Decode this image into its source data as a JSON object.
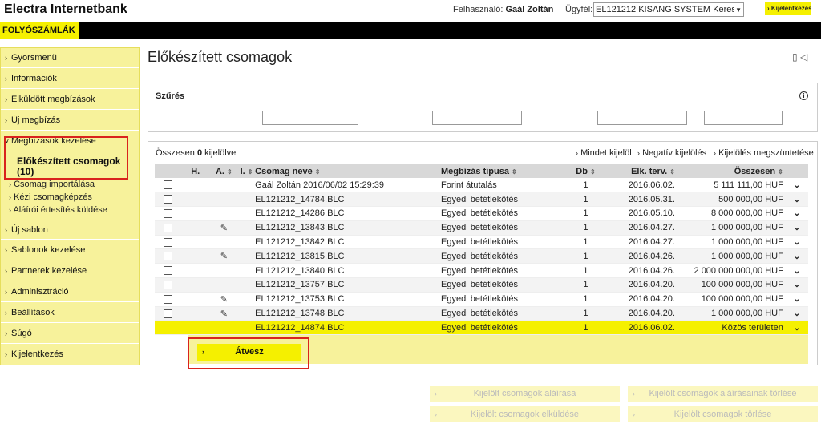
{
  "header": {
    "brand": "Electra Internetbank",
    "user_label": "Felhasználó:",
    "user_name": "Gaál Zoltán",
    "client_label": "Ügyfél:",
    "client_value": "EL121212 KISANG SYSTEM Kereske",
    "logout_button": "Kijelentkezés"
  },
  "nav": {
    "active_tab": "FOLYÓSZÁMLÁK"
  },
  "sidebar": {
    "items": [
      {
        "label": "Gyorsmenü"
      },
      {
        "label": "Információk"
      },
      {
        "label": "Elküldött megbízások"
      },
      {
        "label": "Új megbízás"
      },
      {
        "label": "Megbízások kezelése"
      },
      {
        "label": "Új sablon"
      },
      {
        "label": "Sablonok kezelése"
      },
      {
        "label": "Partnerek kezelése"
      },
      {
        "label": "Adminisztráció"
      },
      {
        "label": "Beállítások"
      },
      {
        "label": "Súgó"
      },
      {
        "label": "Kijelentkezés"
      }
    ],
    "submenu_title": "Előkészített csomagok (10)",
    "subitems": [
      {
        "label": "Csomag importálása"
      },
      {
        "label": "Kézi csomagképzés"
      },
      {
        "label": "Aláírói értesítés küldése"
      }
    ]
  },
  "main": {
    "title": "Előkészített csomagok",
    "filter_title": "Szűrés",
    "selected_prefix": "Összesen",
    "selected_count": "0",
    "selected_suffix": "kijelölve",
    "select_all": "Mindet kijelöl",
    "invert_selection": "Negatív kijelölés",
    "clear_selection": "Kijelölés megszüntetése",
    "columns": [
      "H.",
      "A.",
      "I.",
      "Csomag neve",
      "Megbízás típusa",
      "Db",
      "Elk. terv.",
      "Összesen"
    ],
    "rows": [
      {
        "signed": false,
        "name": "Gaál Zoltán 2016/06/02 15:29:39",
        "type": "Forint átutalás",
        "count": "1",
        "date": "2016.06.02.",
        "total": "5 111 111,00 HUF"
      },
      {
        "signed": false,
        "name": "EL121212_14784.BLC",
        "type": "Egyedi betétlekötés",
        "count": "1",
        "date": "2016.05.31.",
        "total": "500 000,00 HUF"
      },
      {
        "signed": false,
        "name": "EL121212_14286.BLC",
        "type": "Egyedi betétlekötés",
        "count": "1",
        "date": "2016.05.10.",
        "total": "8 000 000,00 HUF"
      },
      {
        "signed": true,
        "name": "EL121212_13843.BLC",
        "type": "Egyedi betétlekötés",
        "count": "1",
        "date": "2016.04.27.",
        "total": "1 000 000,00 HUF"
      },
      {
        "signed": false,
        "name": "EL121212_13842.BLC",
        "type": "Egyedi betétlekötés",
        "count": "1",
        "date": "2016.04.27.",
        "total": "1 000 000,00 HUF"
      },
      {
        "signed": true,
        "name": "EL121212_13815.BLC",
        "type": "Egyedi betétlekötés",
        "count": "1",
        "date": "2016.04.26.",
        "total": "1 000 000,00 HUF"
      },
      {
        "signed": false,
        "name": "EL121212_13840.BLC",
        "type": "Egyedi betétlekötés",
        "count": "1",
        "date": "2016.04.26.",
        "total": "2 000 000 000,00 HUF"
      },
      {
        "signed": false,
        "name": "EL121212_13757.BLC",
        "type": "Egyedi betétlekötés",
        "count": "1",
        "date": "2016.04.20.",
        "total": "100 000 000,00 HUF"
      },
      {
        "signed": true,
        "name": "EL121212_13753.BLC",
        "type": "Egyedi betétlekötés",
        "count": "1",
        "date": "2016.04.20.",
        "total": "100 000 000,00 HUF"
      },
      {
        "signed": true,
        "name": "EL121212_13748.BLC",
        "type": "Egyedi betétlekötés",
        "count": "1",
        "date": "2016.04.20.",
        "total": "1 000 000,00 HUF"
      }
    ],
    "highlight_row": {
      "name": "EL121212_14874.BLC",
      "type": "Egyedi betétlekötés",
      "count": "1",
      "date": "2016.06.02.",
      "total": "Közös területen"
    },
    "atvesz_button": "Átvesz",
    "bottom_buttons": {
      "sign_selected": "Kijelölt csomagok aláírása",
      "delete_signatures": "Kijelölt csomagok aláírásainak törlése",
      "send_selected": "Kijelölt csomagok elküldése",
      "delete_selected": "Kijelölt csomagok törlése"
    }
  },
  "colors": {
    "accent_yellow": "#f5f000",
    "sidebar_bg": "#f7f29b",
    "highlight_red": "#d9231d"
  }
}
